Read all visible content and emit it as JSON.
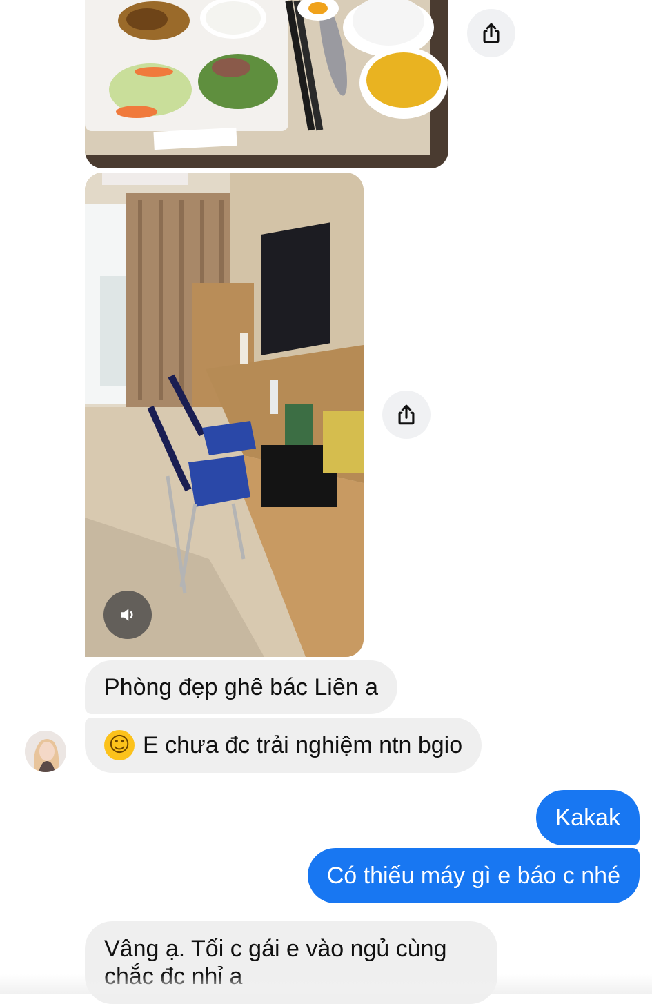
{
  "conversation": {
    "messages": [
      {
        "id": "m1",
        "direction": "incoming",
        "text": "Phòng đẹp ghê bác Liên a"
      },
      {
        "id": "m2",
        "direction": "incoming",
        "emoji_name": "tears-of-joy",
        "text": "E chưa đc trải nghiệm ntn bgio"
      },
      {
        "id": "m3",
        "direction": "outgoing",
        "text": "Kakak"
      },
      {
        "id": "m4",
        "direction": "outgoing",
        "text": "Có thiếu máy gì e báo c nhé"
      },
      {
        "id": "m5",
        "direction": "incoming",
        "text": "Vâng ạ. Tối c gái e vào ngủ cùng chắc đc nhỉ a"
      }
    ],
    "attachments": [
      {
        "type": "photo",
        "subject": "meal tray"
      },
      {
        "type": "video",
        "subject": "hotel room"
      }
    ]
  },
  "icons": {
    "share": "share-icon",
    "sound": "speaker-icon",
    "reaction": "tears-of-joy-emoji"
  },
  "colors": {
    "outgoing_bubble": "#1877f2",
    "incoming_bubble": "#efefef",
    "share_button_bg": "#f0f1f3"
  }
}
